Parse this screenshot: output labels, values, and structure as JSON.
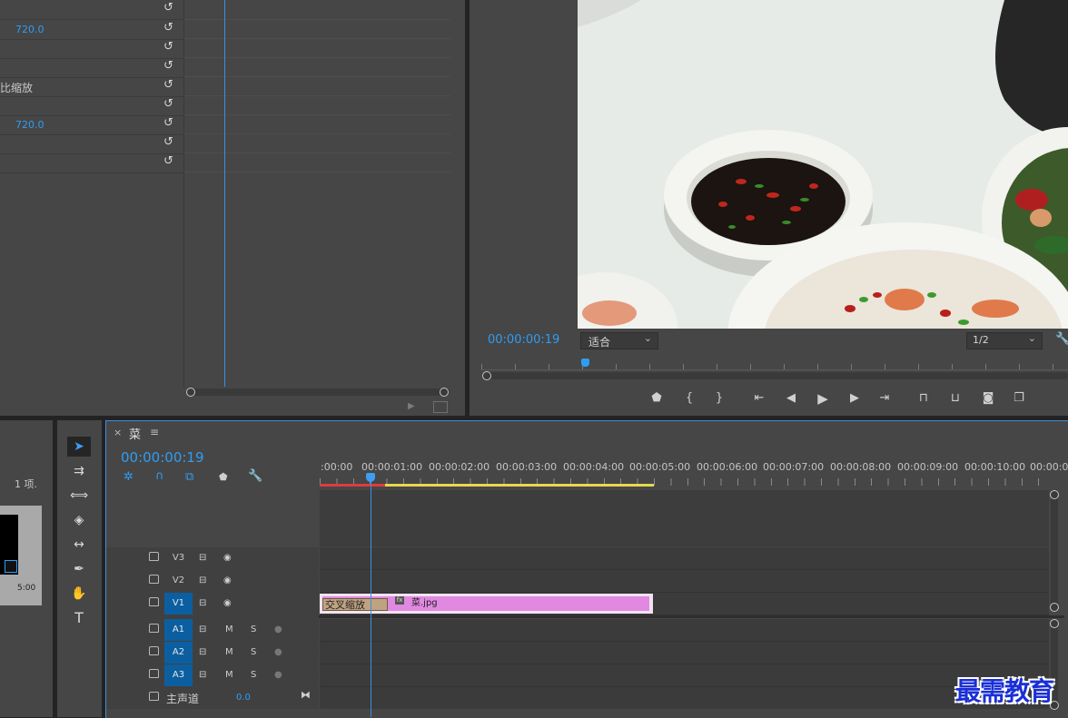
{
  "colors": {
    "accent": "#2f9df4",
    "clip_pink": "#e189e1",
    "transition": "#bfa381",
    "work_red": "#e03c3c",
    "work_yellow": "#e6d94a"
  },
  "effect_controls": {
    "rows": [
      {
        "value": ""
      },
      {
        "value": "720.0"
      },
      {
        "value": ""
      },
      {
        "value": ""
      },
      {
        "label": "比缩放"
      },
      {
        "value": ""
      },
      {
        "value": "720.0"
      },
      {
        "value": ""
      },
      {
        "value": ""
      }
    ],
    "reset_glyph": "↺"
  },
  "program": {
    "timecode": "00:00:00:19",
    "fit_label": "适合",
    "resolution": "1/2",
    "dropdown_glyph": "⌄"
  },
  "project": {
    "count": "1 项.",
    "duration": "5:00"
  },
  "timeline": {
    "sequence_name": "菜",
    "close_glyph": "×",
    "menu_glyph": "≡",
    "timecode": "00:00:00:19",
    "ruler": [
      ":00:00",
      "00:00:01:00",
      "00:00:02:00",
      "00:00:03:00",
      "00:00:04:00",
      "00:00:05:00",
      "00:00:06:00",
      "00:00:07:00",
      "00:00:08:00",
      "00:00:09:00",
      "00:00:10:00",
      "00:00:0"
    ],
    "video_tracks": [
      "V3",
      "V2",
      "V1"
    ],
    "audio_tracks": [
      "A1",
      "A2",
      "A3"
    ],
    "mute": "M",
    "solo": "S",
    "master_label": "主声道",
    "master_value": "0.0",
    "transition_label": "交叉缩放",
    "clip_label": "菜.jpg",
    "fx_badge": "fx"
  },
  "watermark": "最需教育"
}
